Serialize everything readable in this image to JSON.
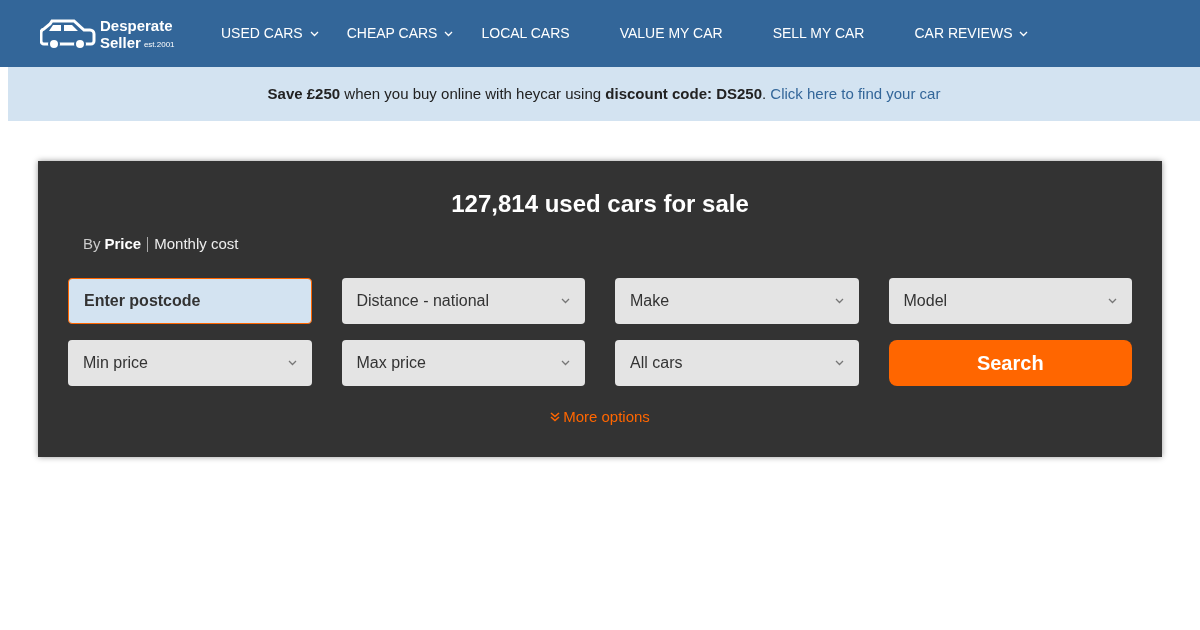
{
  "logo": {
    "line_1": "Desperate",
    "line_2": "Seller",
    "tagline": "est.2001"
  },
  "nav": [
    {
      "label": "USED CARS",
      "has_dropdown": true
    },
    {
      "label": "CHEAP CARS",
      "has_dropdown": true
    },
    {
      "label": "LOCAL CARS",
      "has_dropdown": false
    },
    {
      "label": "VALUE MY CAR",
      "has_dropdown": false
    },
    {
      "label": "SELL MY CAR",
      "has_dropdown": false
    },
    {
      "label": "CAR REVIEWS",
      "has_dropdown": true
    }
  ],
  "banner": {
    "text": "**Save £250** when you buy online with heycar using **discount code: DS250**.",
    "link": "Click here to find your car"
  },
  "search_panel": {
    "title": "127,814 used cars for sale",
    "mode_label": "By",
    "modes": [
      {
        "label": "Price",
        "selected": true
      },
      {
        "label": "Monthly cost",
        "selected": false
      }
    ],
    "fields": [
      {
        "kind": "input",
        "placeholder": "Enter postcode"
      },
      {
        "kind": "select",
        "value": "Distance - national"
      },
      {
        "kind": "select",
        "value": "Make"
      },
      {
        "kind": "select",
        "value": "Model"
      },
      {
        "kind": "select",
        "value": "Min price"
      },
      {
        "kind": "select",
        "value": "Max price"
      },
      {
        "kind": "select",
        "value": "All cars"
      },
      {
        "kind": "button",
        "label": "Search"
      }
    ],
    "more_options": "More options"
  }
}
